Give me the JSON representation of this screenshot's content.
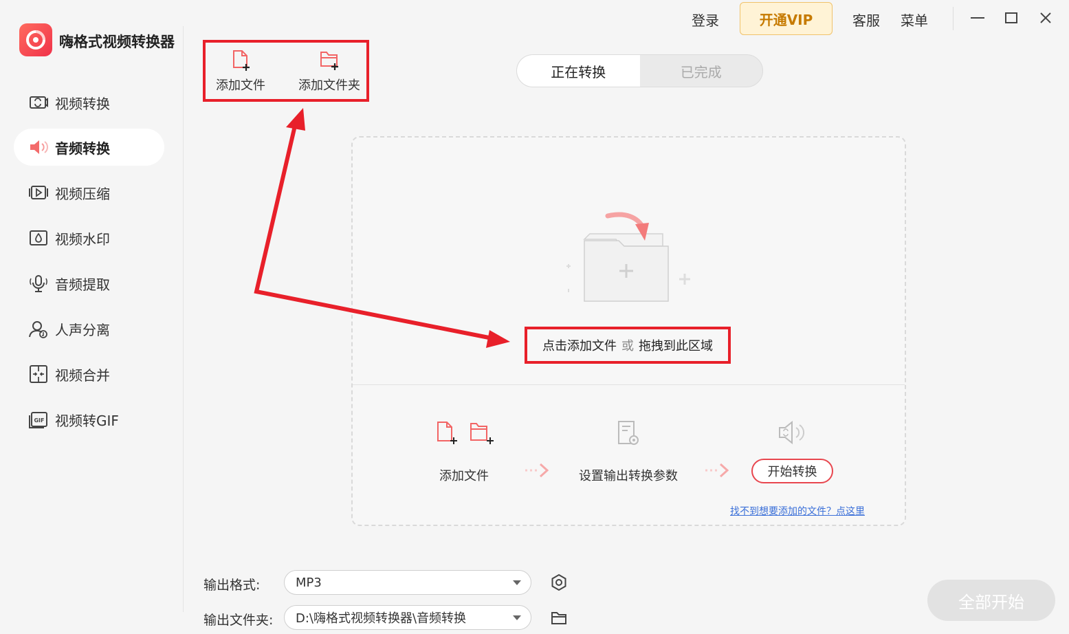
{
  "app": {
    "title": "嗨格式视频转换器"
  },
  "sidebar": {
    "items": [
      {
        "label": "视频转换",
        "icon": "video-convert-icon"
      },
      {
        "label": "音频转换",
        "icon": "audio-convert-icon",
        "active": true
      },
      {
        "label": "视频压缩",
        "icon": "video-compress-icon"
      },
      {
        "label": "视频水印",
        "icon": "video-watermark-icon"
      },
      {
        "label": "音频提取",
        "icon": "audio-extract-icon"
      },
      {
        "label": "人声分离",
        "icon": "vocal-separate-icon"
      },
      {
        "label": "视频合并",
        "icon": "video-merge-icon"
      },
      {
        "label": "视频转GIF",
        "icon": "video-gif-icon"
      }
    ]
  },
  "topbar": {
    "login": "登录",
    "vip": "开通VIP",
    "support": "客服",
    "menu": "菜单"
  },
  "toolbar": {
    "add_file": "添加文件",
    "add_folder": "添加文件夹"
  },
  "tabs": {
    "converting": "正在转换",
    "completed": "已完成"
  },
  "dropzone": {
    "hint_part1": "点击添加文件",
    "hint_or": "或",
    "hint_part2": "拖拽到此区域"
  },
  "steps": {
    "step1": "添加文件",
    "step2": "设置输出转换参数",
    "step3": "开始转换"
  },
  "help_link": "找不到想要添加的文件？点这里",
  "output": {
    "format_label": "输出格式:",
    "format_value": "MP3",
    "folder_label": "输出文件夹:",
    "folder_value": "D:\\嗨格式视频转换器\\音频转换"
  },
  "start_all": "全部开始",
  "colors": {
    "accent": "#e8464e",
    "annotation": "#e8202a",
    "vip_text": "#c67a00",
    "link": "#3a6fd8"
  }
}
